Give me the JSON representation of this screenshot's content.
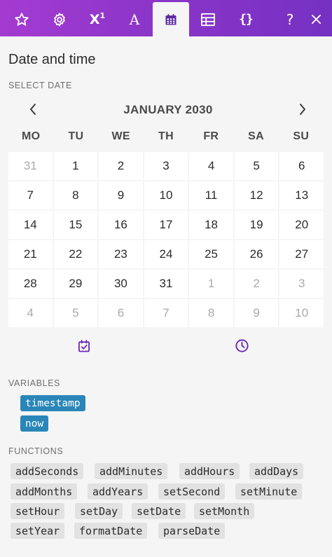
{
  "toolbar": {
    "superscript": "X",
    "superscript_mark": "1",
    "text_label": "A",
    "braces_label": "{}",
    "help_label": "?",
    "close_label": "×"
  },
  "panel": {
    "title": "Date and time",
    "select_date_label": "SELECT DATE"
  },
  "calendar": {
    "month": "JANUARY 2030",
    "weekdays": [
      "MO",
      "TU",
      "WE",
      "TH",
      "FR",
      "SA",
      "SU"
    ],
    "weeks": [
      [
        "31",
        "1",
        "2",
        "3",
        "4",
        "5",
        "6"
      ],
      [
        "7",
        "8",
        "9",
        "10",
        "11",
        "12",
        "13"
      ],
      [
        "14",
        "15",
        "16",
        "17",
        "18",
        "19",
        "20"
      ],
      [
        "21",
        "22",
        "23",
        "24",
        "25",
        "26",
        "27"
      ],
      [
        "28",
        "29",
        "30",
        "31",
        "1",
        "2",
        "3"
      ],
      [
        "4",
        "5",
        "6",
        "7",
        "8",
        "9",
        "10"
      ]
    ],
    "muted": [
      [
        true,
        false,
        false,
        false,
        false,
        false,
        false
      ],
      [
        false,
        false,
        false,
        false,
        false,
        false,
        false
      ],
      [
        false,
        false,
        false,
        false,
        false,
        false,
        false
      ],
      [
        false,
        false,
        false,
        false,
        false,
        false,
        false
      ],
      [
        false,
        false,
        false,
        false,
        true,
        true,
        true
      ],
      [
        true,
        true,
        true,
        true,
        true,
        true,
        true
      ]
    ]
  },
  "variables": {
    "label": "VARIABLES",
    "items": [
      "timestamp",
      "now"
    ]
  },
  "functions": {
    "label": "FUNCTIONS",
    "rows": [
      [
        "addSeconds",
        "addMinutes",
        "addHours",
        "addDays"
      ],
      [
        "addMonths",
        "addYears",
        "setSecond",
        "setMinute"
      ],
      [
        "setHour",
        "setDay",
        "setDate",
        "setMonth"
      ],
      [
        "setYear",
        "formatDate",
        "parseDate"
      ]
    ]
  },
  "colors": {
    "accent": "#7531c3",
    "variable_pill": "#2a86b8",
    "function_pill": "#e2e2e2"
  },
  "icons": {
    "toolbar": [
      "star-icon",
      "gear-icon",
      "superscript-icon",
      "text-icon",
      "calendar-icon",
      "table-icon",
      "braces-icon",
      "help-icon",
      "close-icon"
    ],
    "calendar_nav": [
      "chevron-left-icon",
      "chevron-right-icon"
    ],
    "mode": [
      "calendar-check-icon",
      "clock-icon"
    ]
  }
}
